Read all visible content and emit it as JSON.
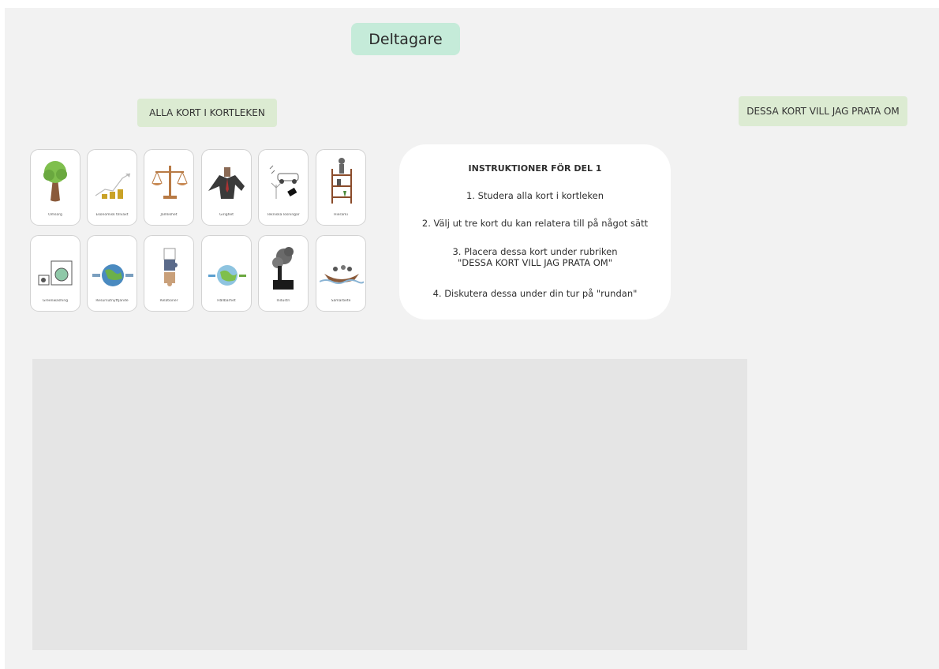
{
  "board": {
    "title": "Deltagare",
    "deck_label": "ALLA KORT I KORTLEKEN",
    "selected_label": "DESSA KORT VILL JAG PRATA OM"
  },
  "cards": [
    {
      "caption": "Omsorg",
      "icon": "tree-icon"
    },
    {
      "caption": "Ekonomisk tillväxt",
      "icon": "growth-icon"
    },
    {
      "caption": "Jämlikhet",
      "icon": "scales-icon"
    },
    {
      "caption": "Girighet",
      "icon": "suit-man-icon"
    },
    {
      "caption": "Tekniska lösningar",
      "icon": "tech-icon"
    },
    {
      "caption": "Hierarki",
      "icon": "ladder-icon"
    },
    {
      "caption": "Greenwashing",
      "icon": "washing-machine-icon"
    },
    {
      "caption": "Resursutnyttjande",
      "icon": "globe-icon"
    },
    {
      "caption": "Relationer",
      "icon": "puzzle-icon"
    },
    {
      "caption": "Hållbarhet",
      "icon": "earth-icon"
    },
    {
      "caption": "Industri",
      "icon": "factory-icon"
    },
    {
      "caption": "Samarbete",
      "icon": "boat-icon"
    }
  ],
  "instructions": {
    "title": "INSTRUKTIONER FÖR DEL 1",
    "step1": "1. Studera alla kort i kortleken",
    "step2": "2. Välj ut tre kort du kan relatera till på något sätt",
    "step3a": "3. Placera dessa kort under rubriken",
    "step3b": "\"DESSA KORT VILL JAG PRATA OM\"",
    "step4": "4. Diskutera dessa under din tur på \"rundan\""
  }
}
